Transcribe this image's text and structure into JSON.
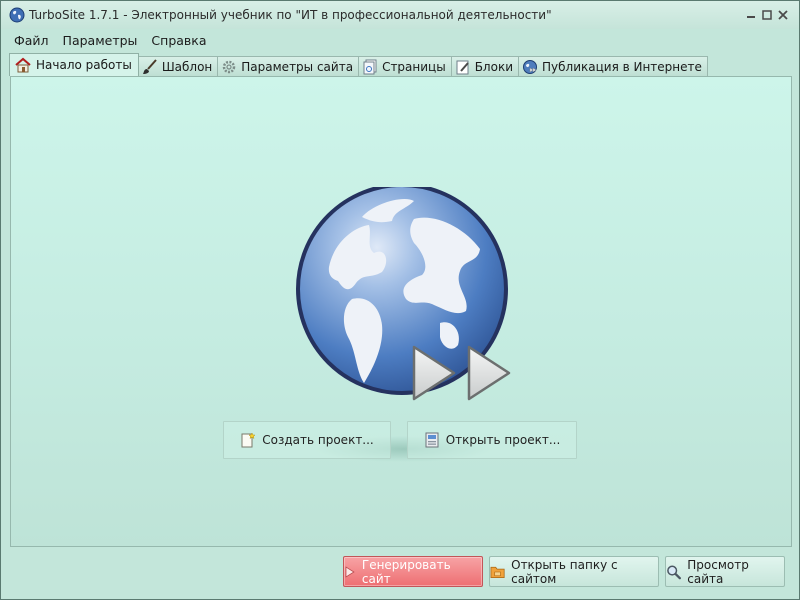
{
  "window": {
    "title": "TurboSite 1.7.1 - Электронный учебник по \"ИТ в профессиональной деятельности\""
  },
  "menu": [
    "Файл",
    "Параметры",
    "Справка"
  ],
  "tabs": [
    {
      "label": "Начало работы",
      "icon": "home-icon",
      "active": true
    },
    {
      "label": "Шаблон",
      "icon": "brush-icon",
      "active": false
    },
    {
      "label": "Параметры сайта",
      "icon": "gear-icon",
      "active": false
    },
    {
      "label": "Страницы",
      "icon": "pages-icon",
      "active": false
    },
    {
      "label": "Блоки",
      "icon": "block-edit-icon",
      "active": false
    },
    {
      "label": "Публикация в Интернете",
      "icon": "globe-publish-icon",
      "active": false
    }
  ],
  "start": {
    "create_label": "Создать проект...",
    "open_label": "Открыть проект..."
  },
  "footer": {
    "generate_label": "Генерировать сайт",
    "open_folder_label": "Открыть папку с сайтом",
    "preview_label": "Просмотр сайта"
  },
  "colors": {
    "window_bg": "#c3e6da",
    "panel_bg": "#cdf5ea",
    "primary_button": "#ee6f72"
  }
}
